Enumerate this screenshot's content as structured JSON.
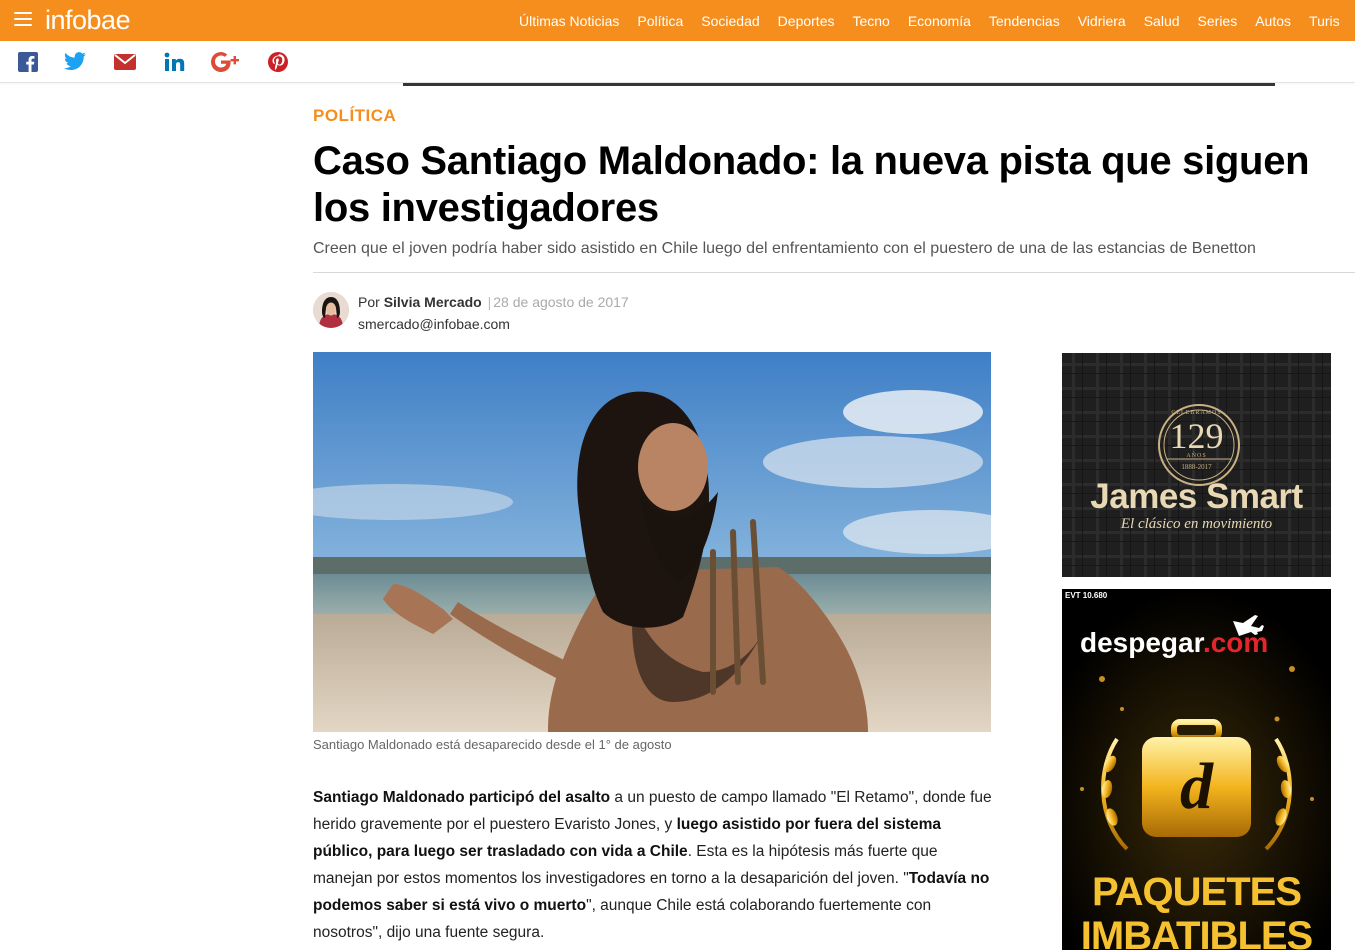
{
  "header": {
    "logo": "infobae",
    "nav": [
      "Últimas Noticias",
      "Política",
      "Sociedad",
      "Deportes",
      "Tecno",
      "Economía",
      "Tendencias",
      "Vidriera",
      "Salud",
      "Series",
      "Autos",
      "Turis"
    ],
    "accent_color": "#f68e1e"
  },
  "share": {
    "icons": [
      "facebook-icon",
      "twitter-icon",
      "email-icon",
      "linkedin-icon",
      "google-plus-icon",
      "pinterest-icon"
    ]
  },
  "article": {
    "category": "POLÍTICA",
    "headline": "Caso Santiago Maldonado: la nueva pista que siguen los investigadores",
    "subheadline": "Creen que el joven podría haber sido asistido en Chile luego del enfrentamiento con el puestero de una de las estancias de Benetton",
    "byline_prefix": "Por",
    "author": "Silvia Mercado",
    "date": "28 de agosto de 2017",
    "email": "smercado@infobae.com",
    "caption": "Santiago Maldonado está desaparecido desde el 1° de agosto",
    "body": [
      {
        "t": "Santiago Maldonado participó del asalto",
        "b": true
      },
      {
        "t": " a un puesto de campo llamado \"El Retamo\", donde fue herido gravemente por el puestero Evaristo Jones, y ",
        "b": false
      },
      {
        "t": "luego asistido por fuera del sistema público, para luego ser trasladado con vida a Chile",
        "b": true
      },
      {
        "t": ". Esta es la hipótesis más fuerte que manejan por estos momentos los investigadores en torno a la desaparición del joven. \"",
        "b": false
      },
      {
        "t": "Todavía no podemos saber si está vivo o muerto",
        "b": true
      },
      {
        "t": "\", aunque Chile está colaborando fuertemente con nosotros\", dijo una fuente segura.",
        "b": false
      }
    ]
  },
  "ads": {
    "ad1": {
      "brand": "James Smart",
      "tagline": "El clásico en movimiento",
      "badge_top": "CELEBRAMOS",
      "badge_number": "129",
      "badge_years": "AÑOS",
      "badge_range": "1888-2017"
    },
    "ad2": {
      "label": "EVT 10.680",
      "brand": "despegar",
      "brand_suffix": ".com",
      "promo_line1": "PAQUETES",
      "promo_line2": "IMBATIBLES",
      "logo_letter": "d"
    }
  }
}
